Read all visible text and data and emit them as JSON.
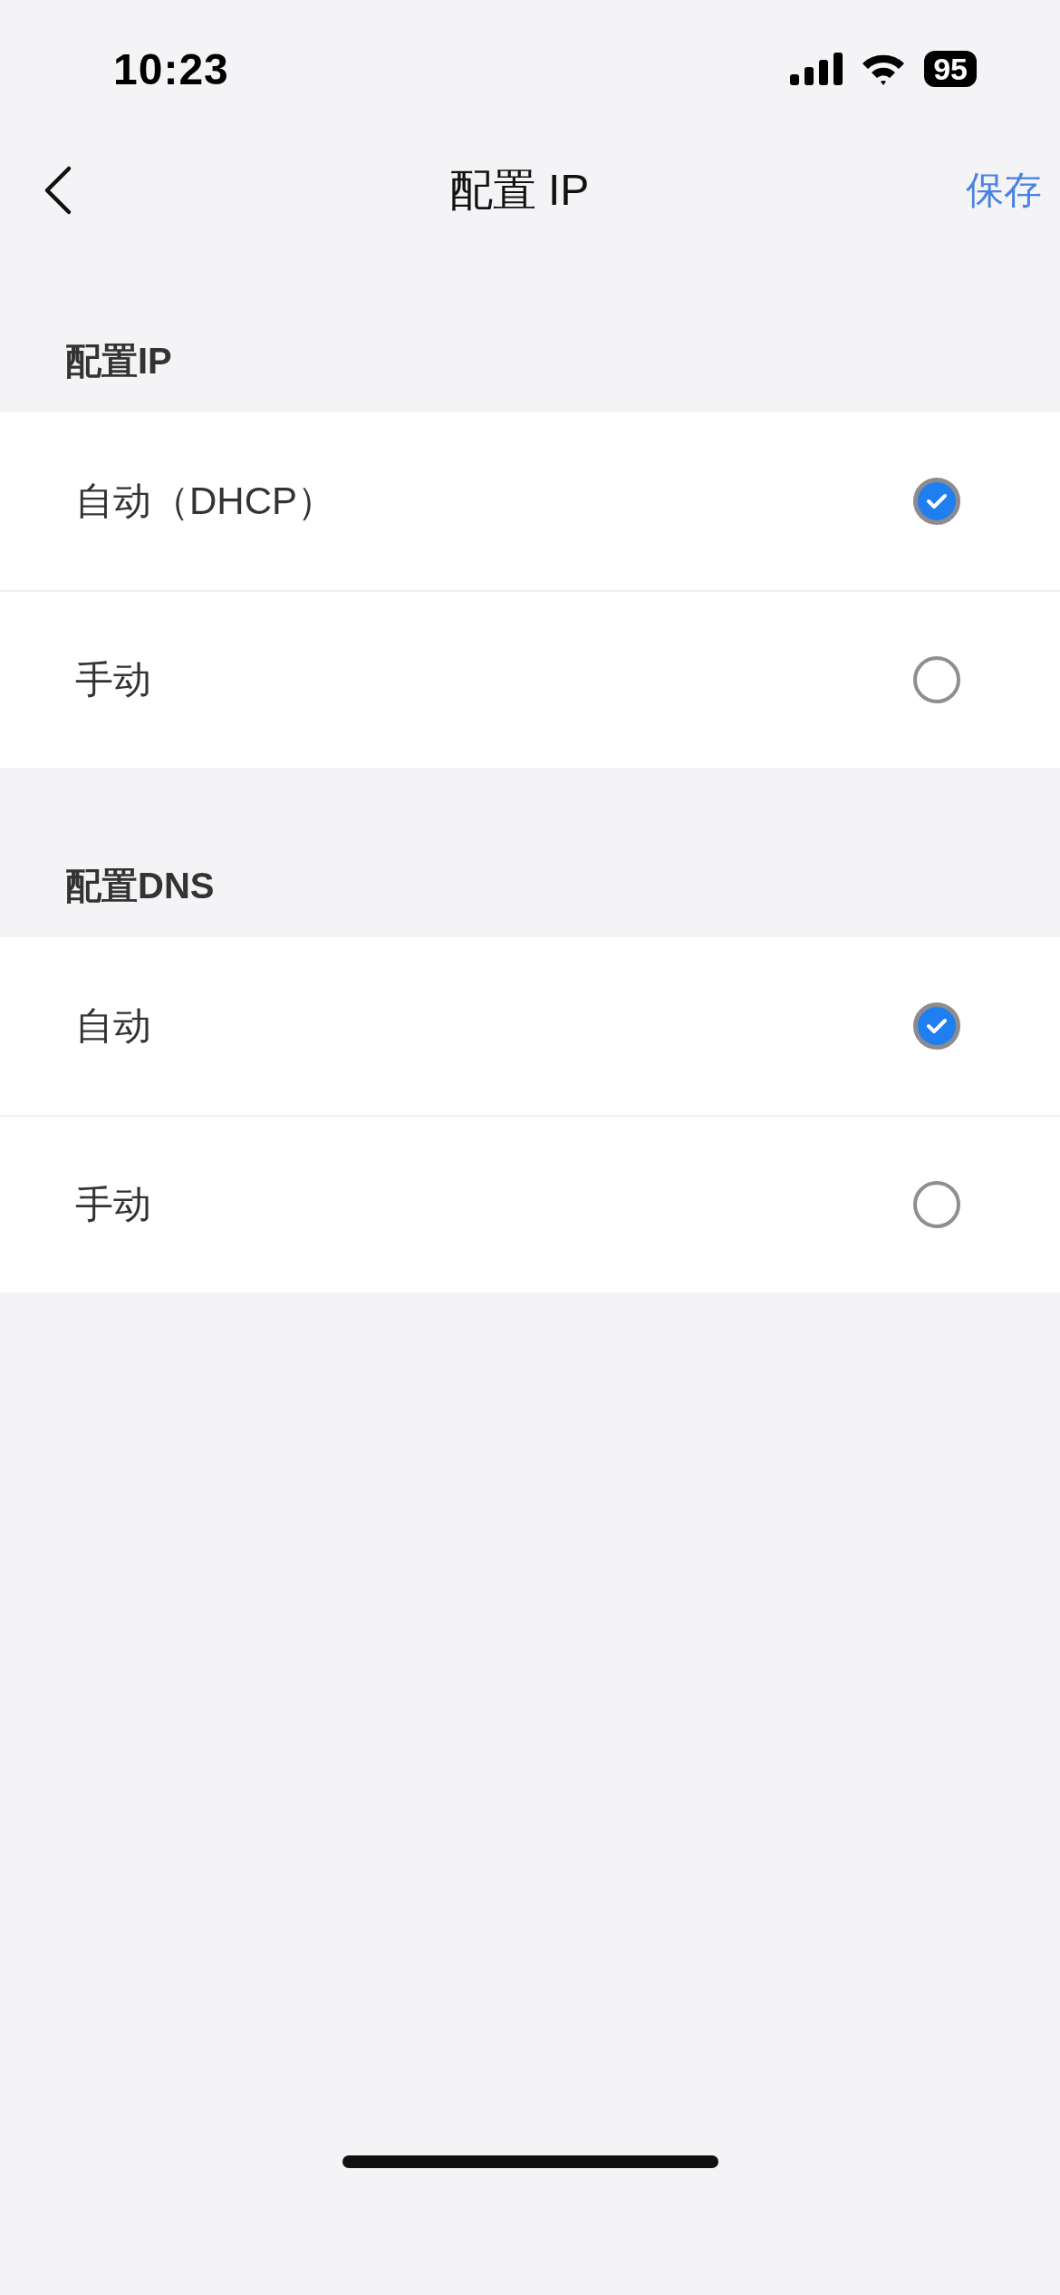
{
  "status_bar": {
    "time": "10:23",
    "battery": "95"
  },
  "nav": {
    "title": "配置 IP",
    "action": "保存"
  },
  "sections": [
    {
      "title": "配置IP",
      "options": [
        {
          "label": "自动（DHCP）",
          "selected": true
        },
        {
          "label": "手动",
          "selected": false
        }
      ]
    },
    {
      "title": "配置DNS",
      "options": [
        {
          "label": "自动",
          "selected": true
        },
        {
          "label": "手动",
          "selected": false
        }
      ]
    }
  ]
}
